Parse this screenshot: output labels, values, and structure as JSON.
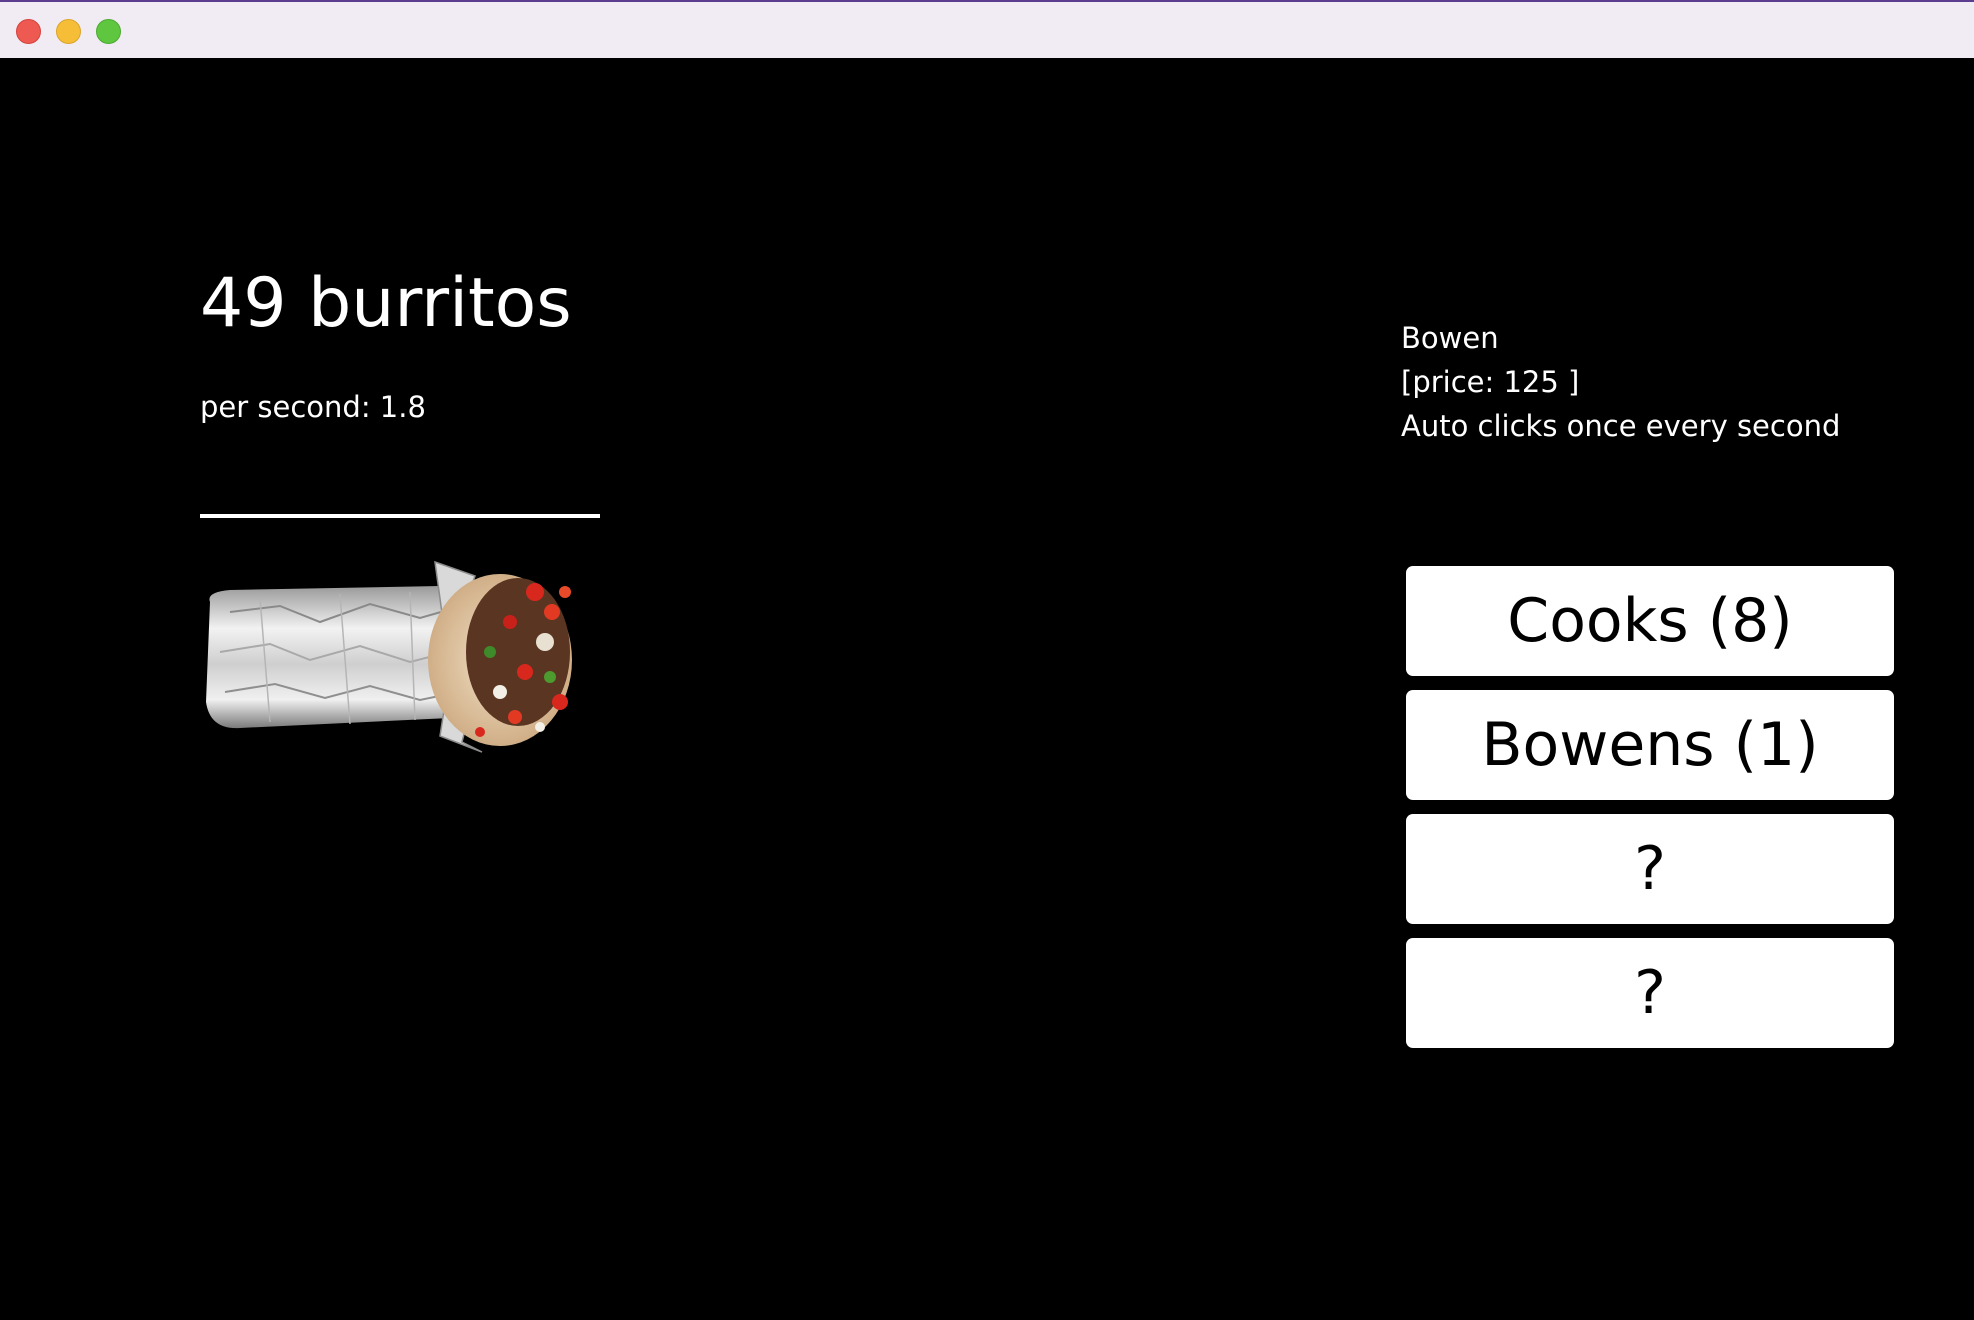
{
  "window": {
    "controls": [
      "close",
      "minimize",
      "zoom"
    ],
    "colors": {
      "close": "#ee5a52",
      "minimize": "#f5be36",
      "zoom": "#5fc73f"
    }
  },
  "stats": {
    "count_label": "49 burritos",
    "per_second_label": "per second: 1.8"
  },
  "burrito_image": {
    "icon": "burrito-icon"
  },
  "info_panel": {
    "name": "Bowen",
    "price": "[price: 125 ]",
    "description": "Auto clicks once every second"
  },
  "shop": {
    "items": [
      {
        "label": "Cooks (8)"
      },
      {
        "label": "Bowens (1)"
      },
      {
        "label": "?"
      },
      {
        "label": "?"
      }
    ]
  },
  "colors": {
    "background": "#000000",
    "text": "#ffffff",
    "button_bg": "#ffffff",
    "button_text": "#000000"
  }
}
